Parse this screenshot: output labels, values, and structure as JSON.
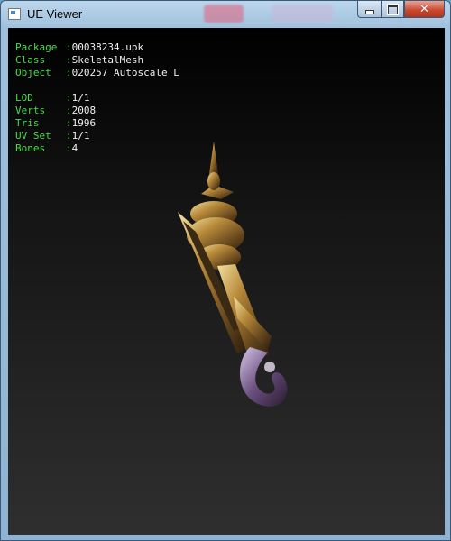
{
  "window": {
    "title": "UE Viewer"
  },
  "titlebar": {
    "minimize_icon": "minimize-icon",
    "maximize_icon": "maximize-icon",
    "close_icon": "close-icon",
    "close_glyph": "✕"
  },
  "info": {
    "object_rows": [
      {
        "label": "Package",
        "sep": ":",
        "value": "00038234.upk"
      },
      {
        "label": "Class",
        "sep": ":",
        "value": "SkeletalMesh"
      },
      {
        "label": "Object",
        "sep": ":",
        "value": "020257_Autoscale_L"
      }
    ],
    "mesh_rows": [
      {
        "label": "LOD",
        "sep": ":",
        "value": "1/1"
      },
      {
        "label": "Verts",
        "sep": ":",
        "value": "2008"
      },
      {
        "label": "Tris",
        "sep": ":",
        "value": "1996"
      },
      {
        "label": "UV Set",
        "sep": ":",
        "value": "1/1"
      },
      {
        "label": "Bones",
        "sep": ":",
        "value": "4"
      }
    ]
  },
  "colors": {
    "label": "#4cd94c",
    "value": "#f0f0f0",
    "close_button": "#c8462e"
  }
}
